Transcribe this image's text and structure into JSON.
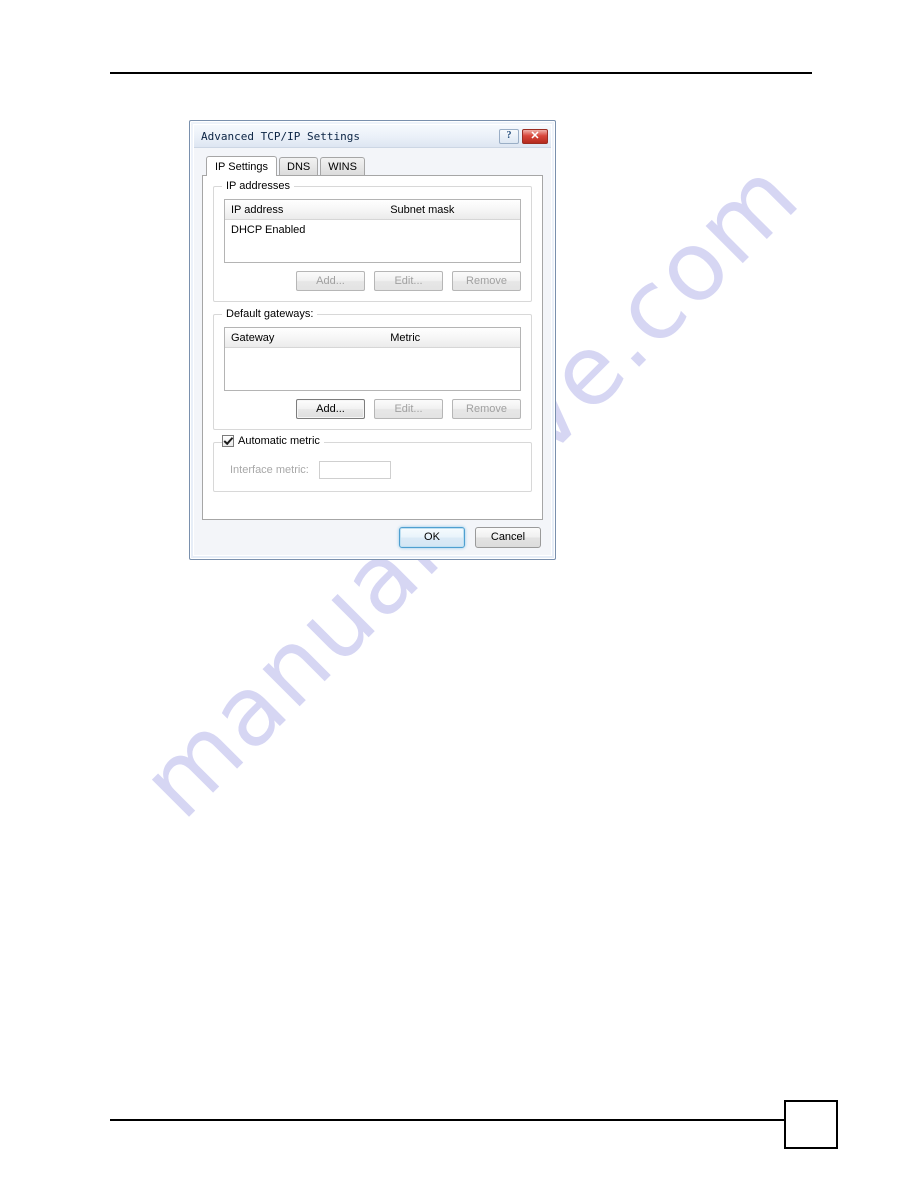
{
  "page": {
    "page_number": ""
  },
  "watermark": {
    "text": "manualshive.com"
  },
  "dialog": {
    "title": "Advanced TCP/IP Settings",
    "help_button": "?",
    "close_button": "✕",
    "tabs": [
      {
        "label": "IP Settings",
        "active": true
      },
      {
        "label": "DNS",
        "active": false
      },
      {
        "label": "WINS",
        "active": false
      }
    ],
    "ip_addresses_group": {
      "legend": "IP addresses",
      "columns": [
        "IP address",
        "Subnet mask"
      ],
      "rows": [
        {
          "ip_address": "DHCP Enabled",
          "subnet_mask": ""
        }
      ],
      "buttons": [
        {
          "label": "Add...",
          "enabled": false
        },
        {
          "label": "Edit...",
          "enabled": false
        },
        {
          "label": "Remove",
          "enabled": false
        }
      ]
    },
    "default_gateways_group": {
      "legend": "Default gateways:",
      "columns": [
        "Gateway",
        "Metric"
      ],
      "rows": [],
      "buttons": [
        {
          "label": "Add...",
          "enabled": true
        },
        {
          "label": "Edit...",
          "enabled": false
        },
        {
          "label": "Remove",
          "enabled": false
        }
      ]
    },
    "automatic_metric_group": {
      "checkbox_label": "Automatic metric",
      "checkbox_checked": true,
      "interface_metric_label": "Interface metric:",
      "interface_metric_value": "",
      "interface_metric_enabled": false
    },
    "footer_buttons": [
      {
        "label": "OK",
        "default": true
      },
      {
        "label": "Cancel",
        "default": false
      }
    ]
  }
}
